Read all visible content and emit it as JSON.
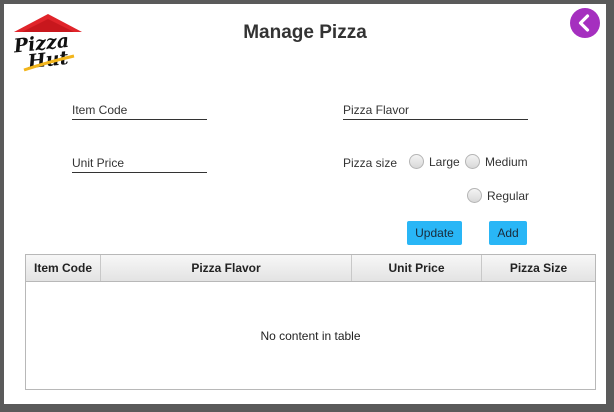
{
  "window": {
    "title": "Manage Pizza"
  },
  "logo": {
    "text_line1": "Pizza",
    "text_line2": "Hut",
    "icon": "pizza-hut-logo"
  },
  "back_button": {
    "icon": "chevron-left-icon",
    "color": "#a52fbf"
  },
  "form": {
    "item_code": {
      "placeholder": "Item Code",
      "value": ""
    },
    "pizza_flavor": {
      "placeholder": "Pizza Flavor",
      "value": ""
    },
    "unit_price": {
      "placeholder": "Unit Price",
      "value": ""
    },
    "pizza_size": {
      "label": "Pizza size",
      "options": [
        "Large",
        "Medium",
        "Regular"
      ],
      "selected": null
    }
  },
  "buttons": {
    "update": "Update",
    "add": "Add",
    "color": "#29b6f6"
  },
  "table": {
    "columns": [
      "Item Code",
      "Pizza Flavor",
      "Unit Price",
      "Pizza Size"
    ],
    "rows": [],
    "empty_text": "No content in table"
  }
}
